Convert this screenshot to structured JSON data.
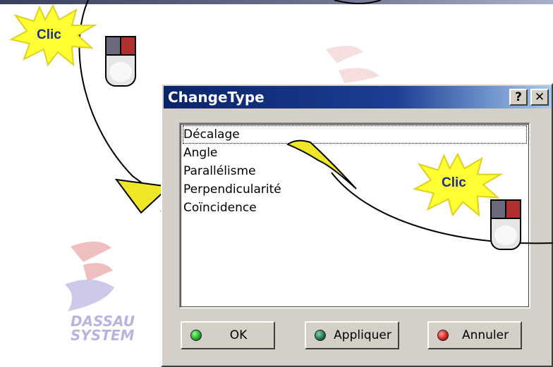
{
  "watermark": {
    "line1": "DASSAU",
    "line2": "SYSTEM"
  },
  "callouts": [
    {
      "text": "Clic"
    },
    {
      "text": "Clic"
    }
  ],
  "dialog": {
    "title": "ChangeType",
    "help_button": "?",
    "close_button": "✕",
    "list": {
      "items": [
        "Décalage",
        "Angle",
        "Parallélisme",
        "Perpendicularité",
        "Coïncidence"
      ],
      "selected": "Décalage"
    },
    "buttons": {
      "ok": "OK",
      "apply": "Appliquer",
      "cancel": "Annuler"
    }
  },
  "colors": {
    "titlebar": "#0a246a",
    "dialog_face": "#d4d0c8",
    "callout_fill": "#ffff33",
    "callout_text": "#1a2f8e",
    "arrow_fill": "#f0e628",
    "ok_led": "#1fa31f",
    "apply_led": "#1f6b4a",
    "cancel_led": "#d41c1c",
    "logo_red": "#e9a3a3",
    "logo_blue": "#b8b4e0"
  }
}
